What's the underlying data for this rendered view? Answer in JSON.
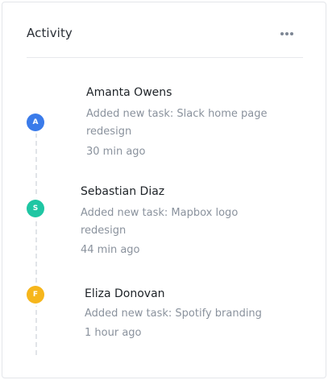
{
  "card": {
    "title": "Activity",
    "menu_icon": "more-horizontal-icon"
  },
  "activities": [
    {
      "initial": "A",
      "avatar_color": "#3a7bea",
      "name": "Amanta Owens",
      "task": "Added new task: Slack home page redesign",
      "time": "30 min ago"
    },
    {
      "initial": "S",
      "avatar_color": "#1fc6a3",
      "name": "Sebastian Diaz",
      "task": "Added new task: Mapbox logo redesign",
      "time": "44 min ago"
    },
    {
      "initial": "F",
      "avatar_color": "#f6b61c",
      "name": "Eliza Donovan",
      "task": "Added new task: Spotify branding",
      "time": "1 hour ago"
    }
  ]
}
